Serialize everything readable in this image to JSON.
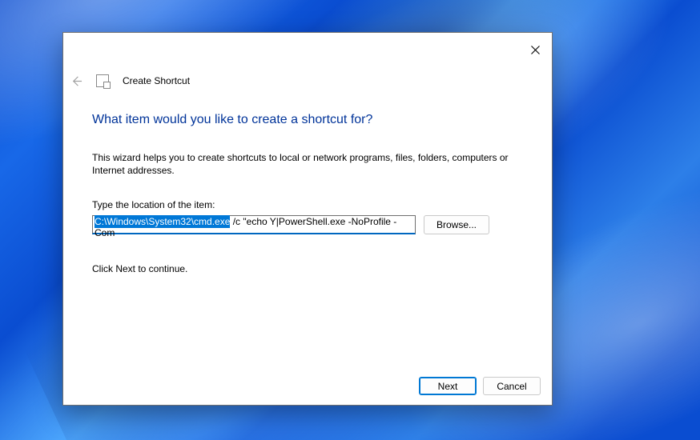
{
  "wizard": {
    "name": "Create Shortcut",
    "heading": "What item would you like to create a shortcut for?",
    "description": "This wizard helps you to create shortcuts to local or network programs, files, folders, computers or Internet addresses.",
    "field_label": "Type the location of the item:",
    "location_selected": "C:\\Windows\\System32\\cmd.exe",
    "location_rest": " /c \"echo Y|PowerShell.exe -NoProfile -Com",
    "browse_label": "Browse...",
    "continue_hint": "Click Next to continue."
  },
  "footer": {
    "next": "Next",
    "cancel": "Cancel"
  }
}
